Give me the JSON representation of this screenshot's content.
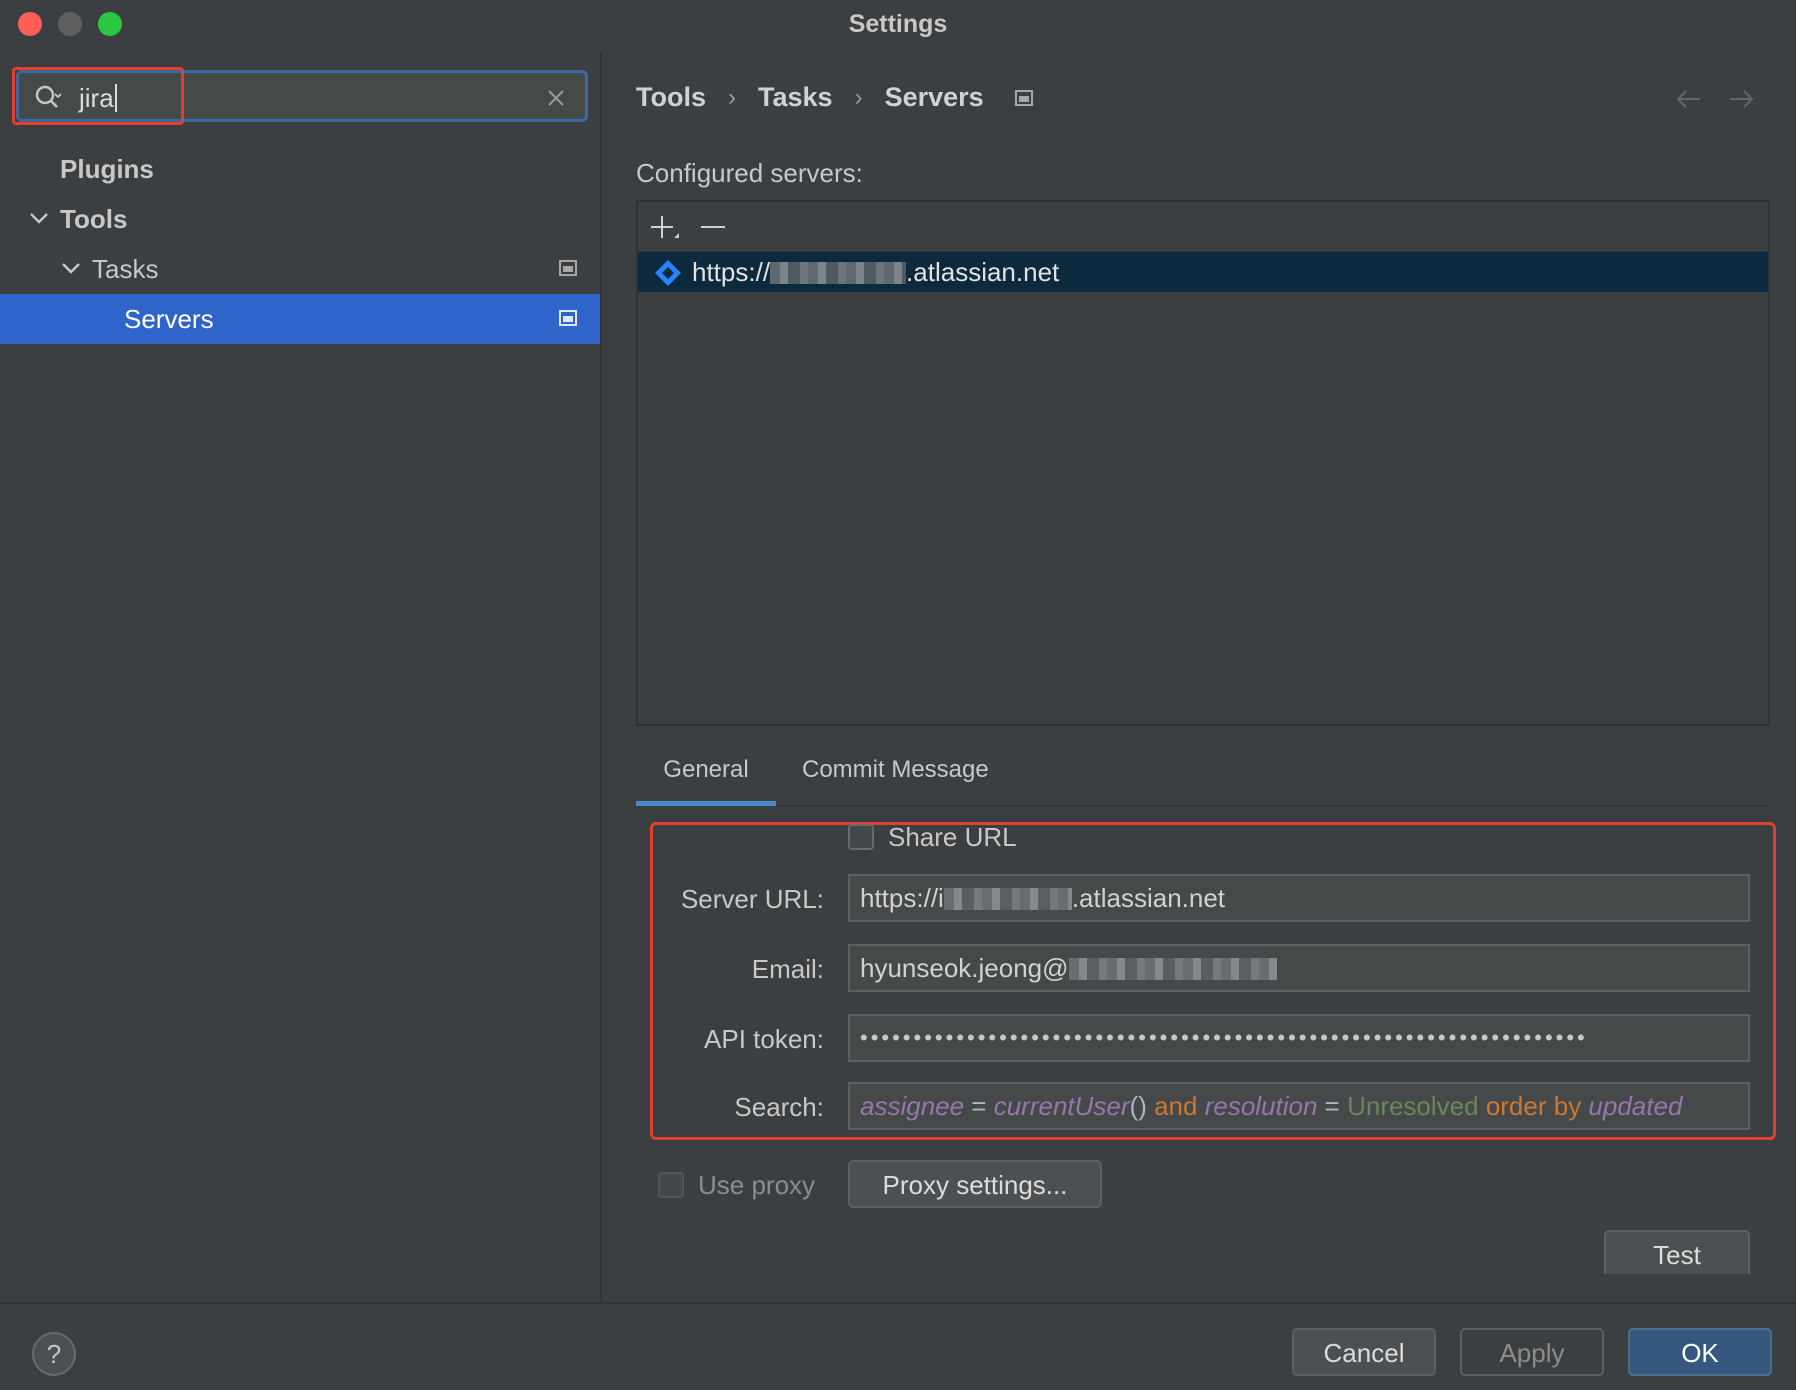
{
  "window": {
    "title": "Settings"
  },
  "sidebar": {
    "search_value": "jira",
    "items": [
      {
        "label": "Plugins"
      },
      {
        "label": "Tools"
      },
      {
        "label": "Tasks"
      },
      {
        "label": "Servers"
      }
    ]
  },
  "breadcrumb": [
    "Tools",
    "Tasks",
    "Servers"
  ],
  "servers": {
    "label": "Configured servers:",
    "rows": [
      {
        "url_prefix": "https://",
        "url_suffix": ".atlassian.net"
      }
    ]
  },
  "tabs": [
    "General",
    "Commit Message"
  ],
  "form": {
    "share_url_label": "Share URL",
    "server_url_label": "Server URL:",
    "server_url_prefix": "https://i",
    "server_url_suffix": ".atlassian.net",
    "email_label": "Email:",
    "email_prefix": "hyunseok.jeong@",
    "api_token_label": "API token:",
    "api_token_value": "••••••••••••••••••••••••••••••••••••••••••••••••••••••••••••••••••••",
    "search_label": "Search:",
    "search_query": {
      "t1": "assignee",
      "t2": " = ",
      "t3": "currentUser",
      "t4": "()",
      "t5": " and ",
      "t6": "resolution",
      "t7": " = ",
      "t8": "Unresolved",
      "t9": " order by ",
      "t10": "updated"
    },
    "use_proxy_label": "Use proxy",
    "proxy_settings_label": "Proxy settings...",
    "test_label": "Test"
  },
  "footer": {
    "help_label": "?",
    "cancel_label": "Cancel",
    "apply_label": "Apply",
    "ok_label": "OK"
  },
  "colors": {
    "selection": "#2f65ca",
    "highlight_box": "#e0402f",
    "primary_button": "#365880",
    "server_row": "#0d293e"
  }
}
